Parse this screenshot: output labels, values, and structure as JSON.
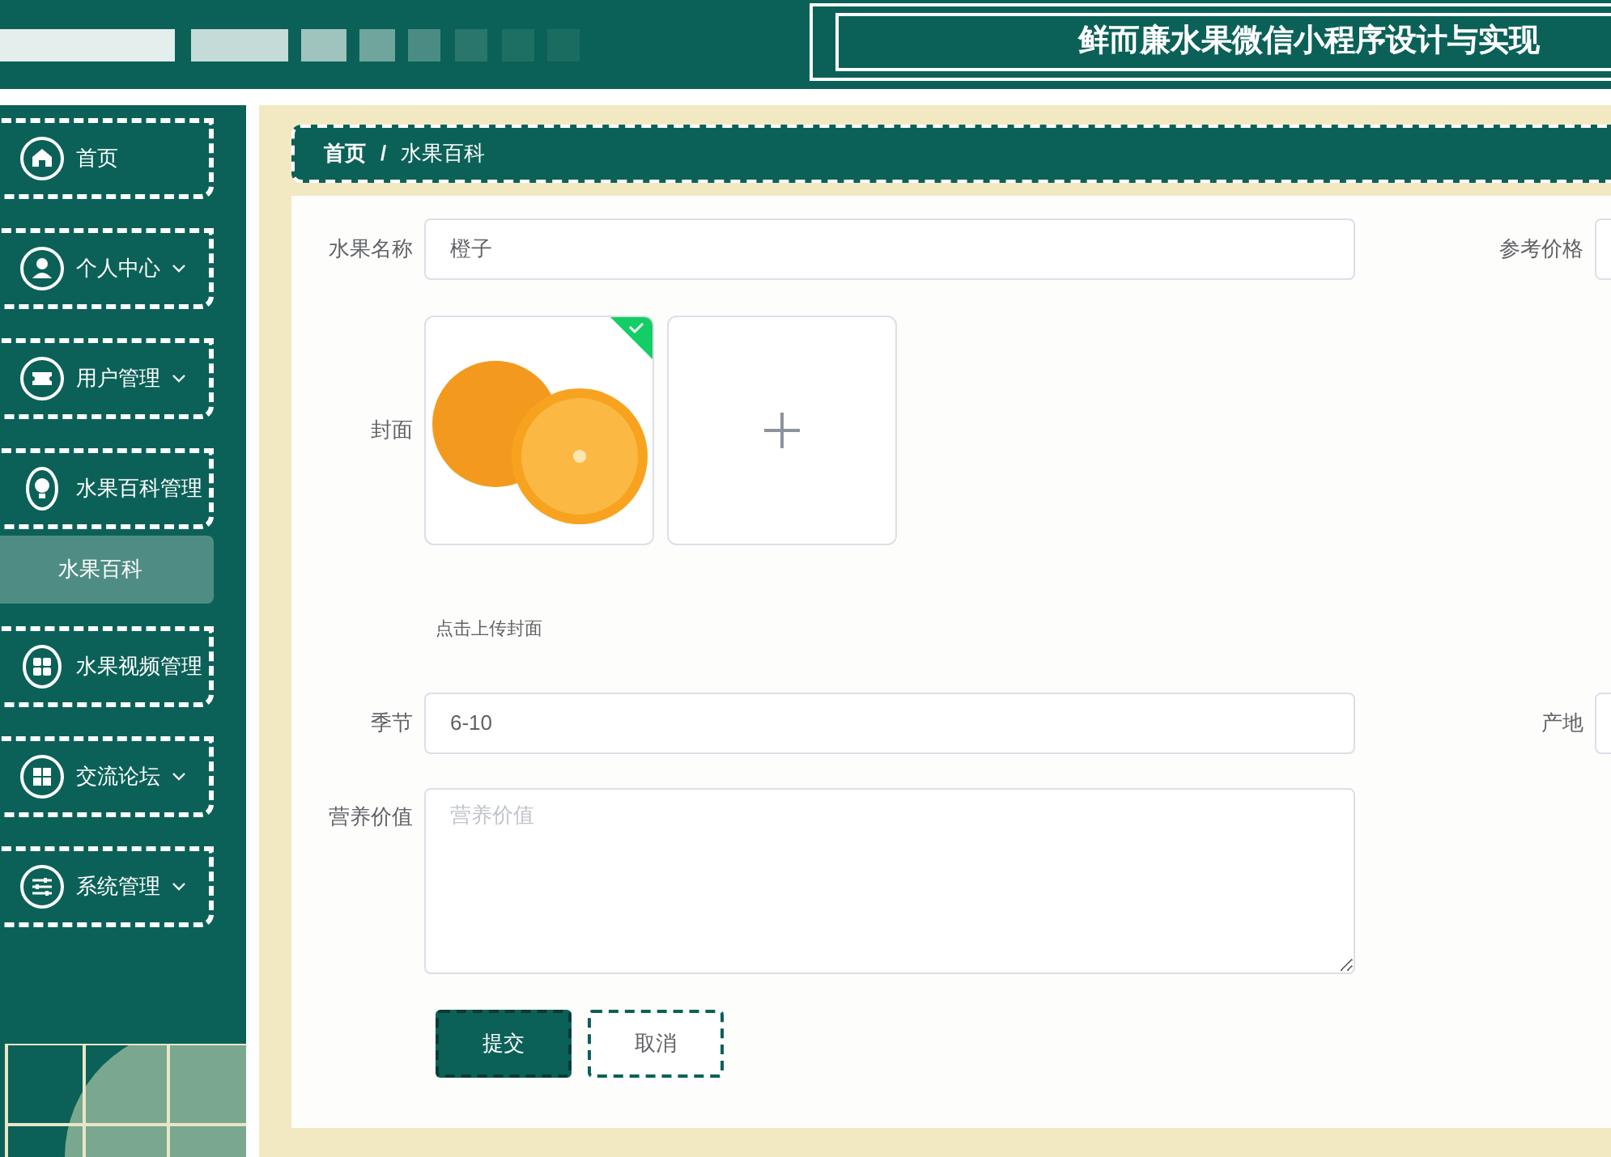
{
  "header": {
    "title": "鲜而廉水果微信小程序设计与实现"
  },
  "sidebar": {
    "items": [
      {
        "label": "首页"
      },
      {
        "label": "个人中心",
        "expanded": false
      },
      {
        "label": "用户管理",
        "expanded": false
      },
      {
        "label": "水果百科管理",
        "expanded": true,
        "children": [
          {
            "label": "水果百科",
            "selected": true
          }
        ]
      },
      {
        "label": "水果视频管理"
      },
      {
        "label": "交流论坛",
        "expanded": false
      },
      {
        "label": "系统管理",
        "expanded": false
      }
    ]
  },
  "breadcrumb": {
    "items": [
      "首页",
      "水果百科"
    ],
    "separator": "/"
  },
  "form": {
    "row_1": [
      {
        "label": "水果名称",
        "value": "橙子"
      },
      {
        "label": "参考价格"
      }
    ],
    "cover": {
      "label": "封面",
      "uploaded": true,
      "hint": "点击上传封面"
    },
    "row_2": [
      {
        "label": "季节",
        "value": "6-10"
      },
      {
        "label": "产地"
      }
    ],
    "nutrition": {
      "label": "营养价值",
      "placeholder": "营养价值"
    },
    "buttons": [
      {
        "label": "提交",
        "kind": "primary"
      },
      {
        "label": "取消",
        "kind": "secondary"
      }
    ]
  }
}
